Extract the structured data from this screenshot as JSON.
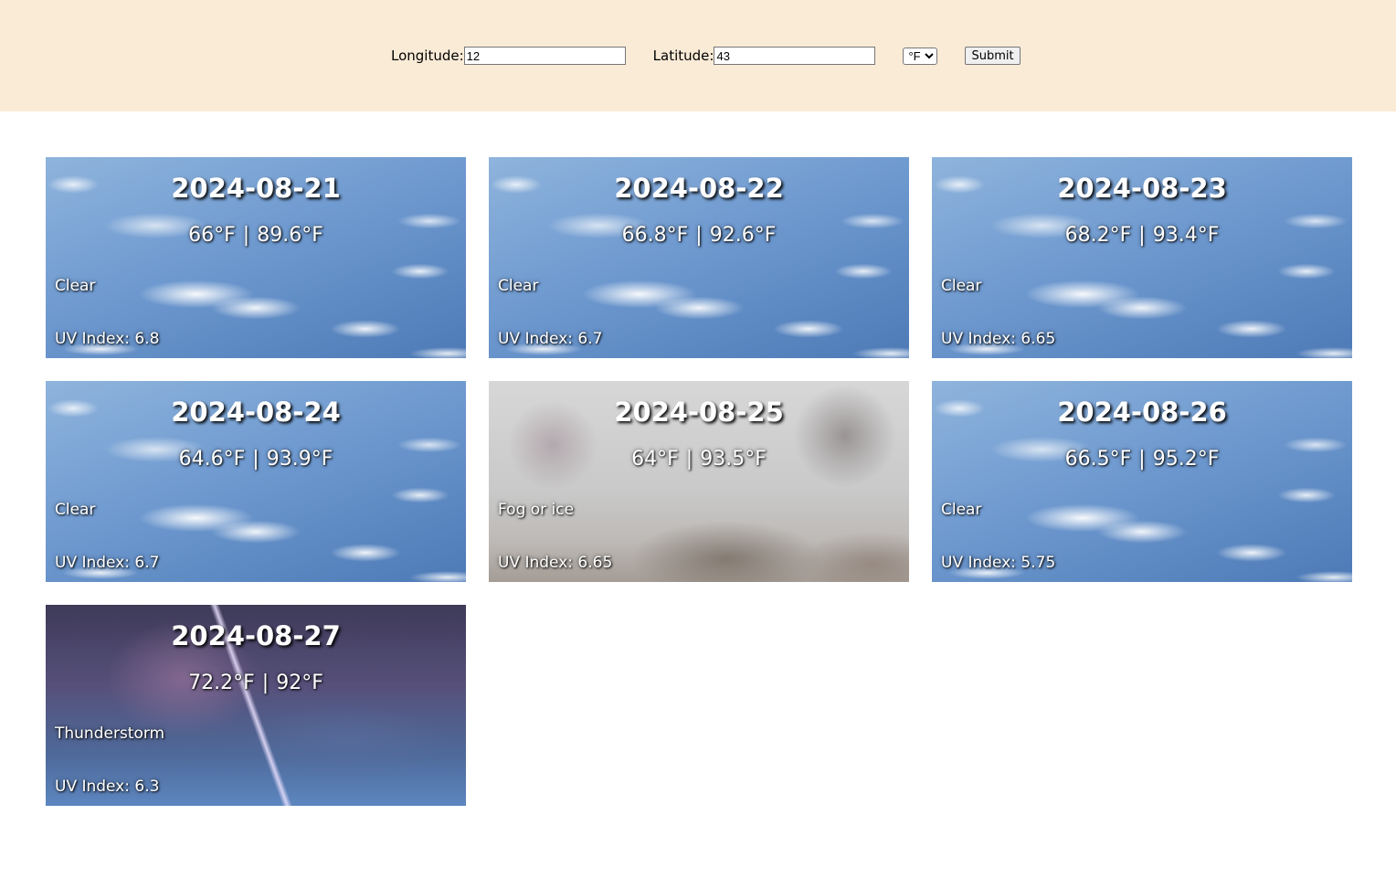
{
  "form": {
    "longitude_label": "Longitude:",
    "longitude_value": "12",
    "latitude_label": "Latitude:",
    "latitude_value": "43",
    "unit_selected": "°F",
    "submit_label": "Submit"
  },
  "forecast": [
    {
      "date": "2024-08-21",
      "low": "66°F",
      "high": "89.6°F",
      "condition": "Clear",
      "uv": "UV Index: 6.8",
      "scene": "clear"
    },
    {
      "date": "2024-08-22",
      "low": "66.8°F",
      "high": "92.6°F",
      "condition": "Clear",
      "uv": "UV Index: 6.7",
      "scene": "clear"
    },
    {
      "date": "2024-08-23",
      "low": "68.2°F",
      "high": "93.4°F",
      "condition": "Clear",
      "uv": "UV Index: 6.65",
      "scene": "clear"
    },
    {
      "date": "2024-08-24",
      "low": "64.6°F",
      "high": "93.9°F",
      "condition": "Clear",
      "uv": "UV Index: 6.7",
      "scene": "clear"
    },
    {
      "date": "2024-08-25",
      "low": "64°F",
      "high": "93.5°F",
      "condition": "Fog or ice",
      "uv": "UV Index: 6.65",
      "scene": "fog"
    },
    {
      "date": "2024-08-26",
      "low": "66.5°F",
      "high": "95.2°F",
      "condition": "Clear",
      "uv": "UV Index: 5.75",
      "scene": "clear"
    },
    {
      "date": "2024-08-27",
      "low": "72.2°F",
      "high": "92°F",
      "condition": "Thunderstorm",
      "uv": "UV Index: 6.3",
      "scene": "storm"
    }
  ],
  "colors": {
    "header_bg": "#faebd7",
    "page_bg": "#ffffff"
  }
}
